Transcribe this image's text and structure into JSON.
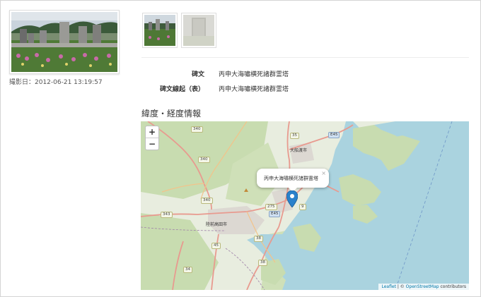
{
  "photo": {
    "date": "撮影日：2012-06-21 13:19:57"
  },
  "info": {
    "rows": [
      {
        "label": "碑文",
        "value": "丙申大海嘯横死諸群霊塔"
      },
      {
        "label": "碑文線起（表）",
        "value": "丙申大海嘯横死諸群霊塔"
      }
    ]
  },
  "map_section": {
    "title": "緯度・経度情報"
  },
  "map": {
    "zoom_in": "+",
    "zoom_out": "−",
    "popup_text": "丙申大海嘯横死諸群霊塔",
    "popup_close": "×",
    "places": {
      "ofunato": "大船渡市",
      "rikuzentakata": "陸前高田市"
    },
    "shields": {
      "r340a": "340",
      "r340b": "340",
      "r343": "343",
      "r45": "45",
      "r38a": "38",
      "r38b": "38",
      "r34": "34",
      "r9": "9",
      "r35": "35",
      "r275": "275",
      "e45a": "E45",
      "e45b": "E45"
    },
    "attribution_leaflet": "Leaflet",
    "attribution_sep": " | © ",
    "attribution_osm": "OpenStreetMap",
    "attribution_tail": " contributors",
    "colors": {
      "land": "#e8eddf",
      "forest": "#c8dcb0",
      "sea": "#aad3df",
      "road": "#e89a8f",
      "marker": "#2a81cb"
    }
  }
}
